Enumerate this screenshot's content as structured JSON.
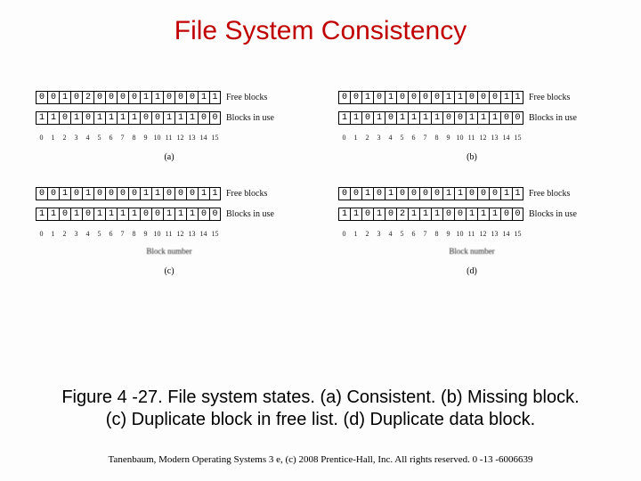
{
  "title": "File System Consistency",
  "rowlabels": {
    "free": "Free blocks",
    "use": "Blocks in use",
    "blocknum": "Block number"
  },
  "indices": [
    "0",
    "1",
    "2",
    "3",
    "4",
    "5",
    "6",
    "7",
    "8",
    "9",
    "10",
    "11",
    "12",
    "13",
    "14",
    "15"
  ],
  "panels": [
    {
      "sub": "(a)",
      "free": [
        "0",
        "0",
        "1",
        "0",
        "2",
        "0",
        "0",
        "0",
        "0",
        "1",
        "1",
        "0",
        "0",
        "0",
        "1",
        "1"
      ],
      "use": [
        "1",
        "1",
        "0",
        "1",
        "0",
        "1",
        "1",
        "1",
        "1",
        "0",
        "0",
        "1",
        "1",
        "1",
        "0",
        "0"
      ]
    },
    {
      "sub": "(b)",
      "free": [
        "0",
        "0",
        "1",
        "0",
        "1",
        "0",
        "0",
        "0",
        "0",
        "1",
        "1",
        "0",
        "0",
        "0",
        "1",
        "1"
      ],
      "use": [
        "1",
        "1",
        "0",
        "1",
        "0",
        "1",
        "1",
        "1",
        "1",
        "0",
        "0",
        "1",
        "1",
        "1",
        "0",
        "0"
      ]
    },
    {
      "sub": "(c)",
      "free": [
        "0",
        "0",
        "1",
        "0",
        "1",
        "0",
        "0",
        "0",
        "0",
        "1",
        "1",
        "0",
        "0",
        "0",
        "1",
        "1"
      ],
      "use": [
        "1",
        "1",
        "0",
        "1",
        "0",
        "1",
        "1",
        "1",
        "1",
        "0",
        "0",
        "1",
        "1",
        "1",
        "0",
        "0"
      ]
    },
    {
      "sub": "(d)",
      "free": [
        "0",
        "0",
        "1",
        "0",
        "1",
        "0",
        "0",
        "0",
        "0",
        "1",
        "1",
        "0",
        "0",
        "0",
        "1",
        "1"
      ],
      "use": [
        "1",
        "1",
        "0",
        "1",
        "0",
        "2",
        "1",
        "1",
        "1",
        "0",
        "0",
        "1",
        "1",
        "1",
        "0",
        "0"
      ]
    }
  ],
  "caption_line1": "Figure 4 -27. File system states. (a) Consistent. (b) Missing block.",
  "caption_line2": "(c) Duplicate block in free list. (d) Duplicate data block.",
  "footer": "Tanenbaum, Modern Operating Systems 3 e, (c) 2008 Prentice-Hall, Inc. All rights reserved. 0 -13 -6006639"
}
